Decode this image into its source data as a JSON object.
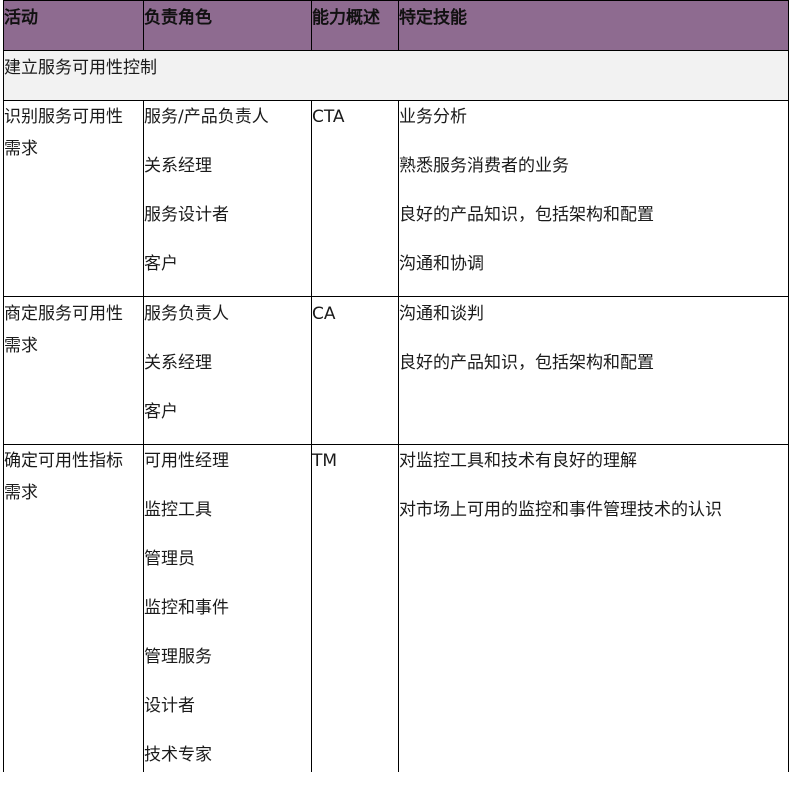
{
  "table": {
    "headers": [
      "活动",
      "负责角色",
      "能力概述",
      "特定技能"
    ],
    "section_title": "建立服务可用性控制",
    "rows": [
      {
        "activity": [
          "识别服务可用性",
          "需求"
        ],
        "roles": [
          "服务/产品负责人",
          "关系经理",
          "服务设计者",
          "客户"
        ],
        "competency": "CTA",
        "skills": [
          "业务分析",
          "熟悉服务消费者的业务",
          "良好的产品知识，包括架构和配置",
          "沟通和协调"
        ]
      },
      {
        "activity": [
          "商定服务可用性",
          "需求"
        ],
        "roles": [
          "服务负责人",
          "关系经理",
          "客户"
        ],
        "competency": "CA",
        "skills": [
          "沟通和谈判",
          "良好的产品知识，包括架构和配置"
        ]
      },
      {
        "activity": [
          "确定可用性指标",
          "需求"
        ],
        "roles": [
          "可用性经理",
          "监控工具",
          "管理员",
          "监控和事件",
          "管理服务",
          "设计者",
          "技术专家"
        ],
        "competency": "TM",
        "skills": [
          "对监控工具和技术有良好的理解",
          "对市场上可用的监控和事件管理技术的认识"
        ]
      }
    ]
  }
}
